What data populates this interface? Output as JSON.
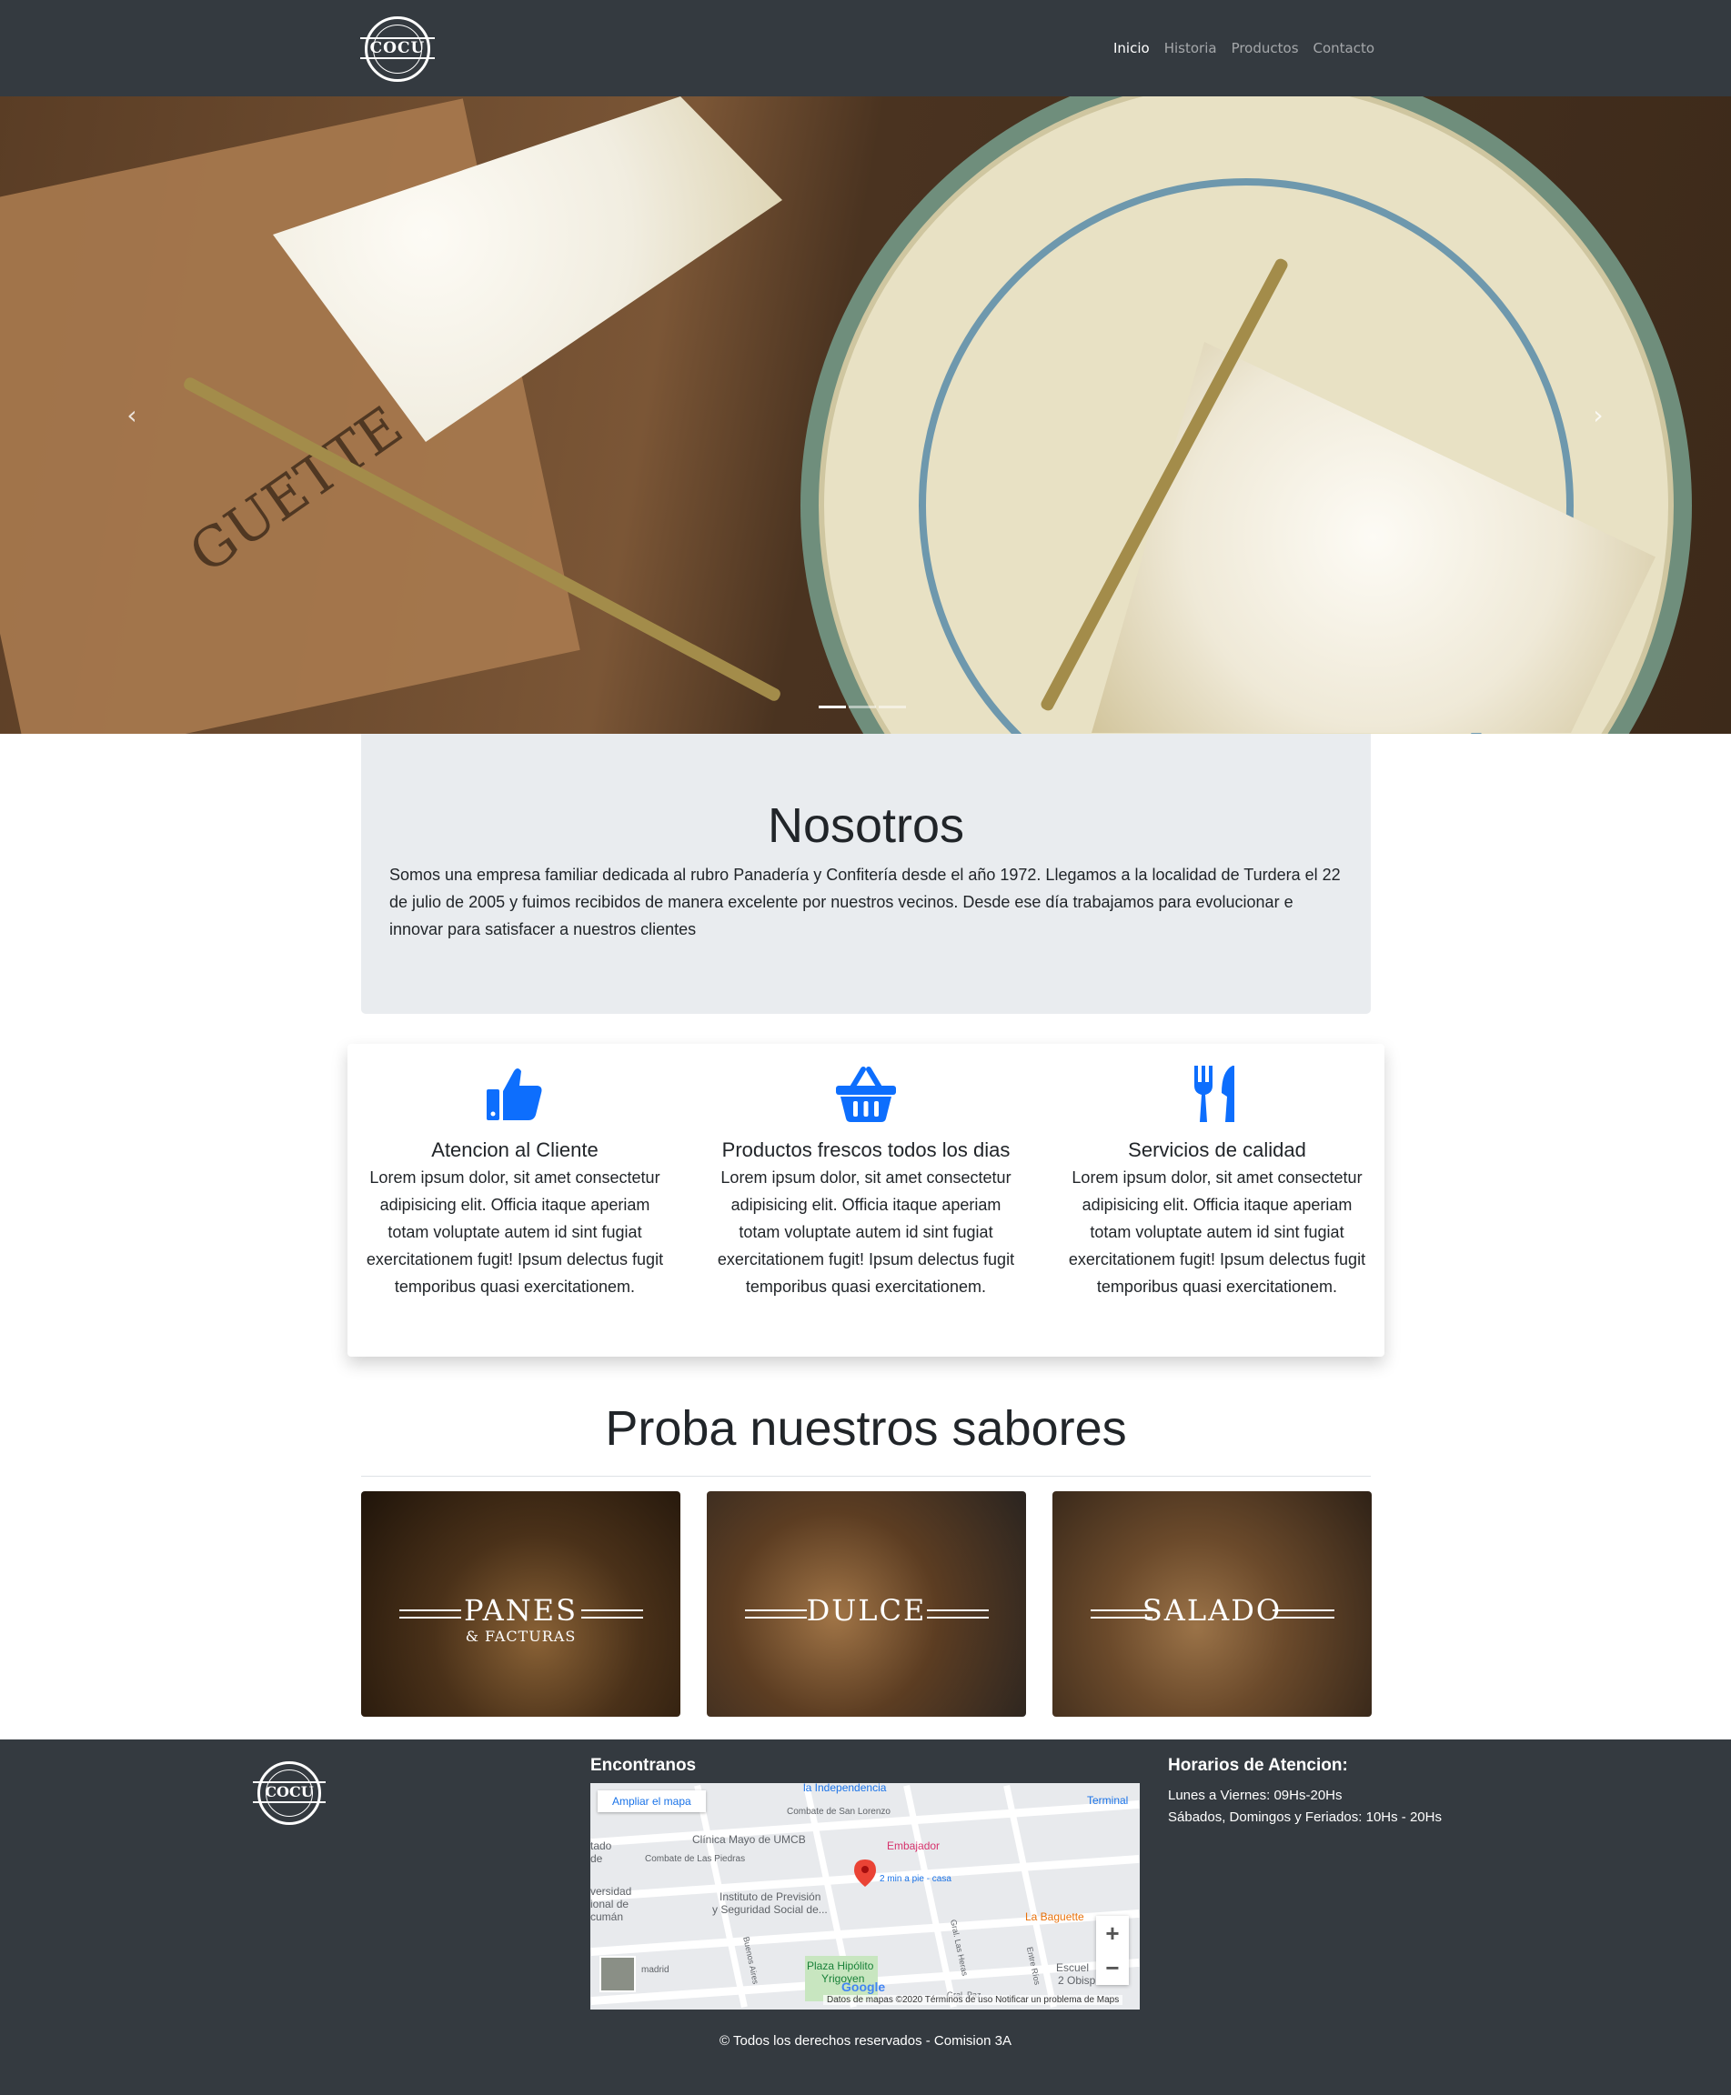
{
  "nav": {
    "logo_text": "COCU",
    "links": [
      {
        "label": "Inicio",
        "active": true
      },
      {
        "label": "Historia",
        "active": false
      },
      {
        "label": "Productos",
        "active": false
      },
      {
        "label": "Contacto",
        "active": false
      }
    ]
  },
  "hero": {
    "slide_count": 3,
    "active_slide": 1,
    "paper_text": "GUETTE"
  },
  "nosotros": {
    "title": "Nosotros",
    "body": "Somos una empresa familiar dedicada al rubro Panadería y Confitería desde el año 1972. Llegamos a la localidad de Turdera el 22 de julio de 2005 y fuimos recibidos de manera excelente por nuestros vecinos. Desde ese día trabajamos para evolucionar e innovar para satisfacer a nuestros clientes"
  },
  "features": [
    {
      "icon": "thumbs-up-icon",
      "title": "Atencion al Cliente",
      "text": "Lorem ipsum dolor, sit amet consectetur adipisicing elit. Officia itaque aperiam totam voluptate autem id sint fugiat exercitationem fugit! Ipsum delectus fugit temporibus quasi exercitationem."
    },
    {
      "icon": "basket-icon",
      "title": "Productos frescos todos los dias",
      "text": "Lorem ipsum dolor, sit amet consectetur adipisicing elit. Officia itaque aperiam totam voluptate autem id sint fugiat exercitationem fugit! Ipsum delectus fugit temporibus quasi exercitationem."
    },
    {
      "icon": "utensils-icon",
      "title": "Servicios de calidad",
      "text": "Lorem ipsum dolor, sit amet consectetur adipisicing elit. Officia itaque aperiam totam voluptate autem id sint fugiat exercitationem fugit! Ipsum delectus fugit temporibus quasi exercitationem."
    }
  ],
  "icon_color": "#0d6efd",
  "sabores": {
    "title": "Proba nuestros sabores",
    "cards": [
      {
        "title": "PANES",
        "subtitle": "& FACTURAS"
      },
      {
        "title": "DULCE",
        "subtitle": ""
      },
      {
        "title": "SALADO",
        "subtitle": ""
      }
    ]
  },
  "footer": {
    "logo_text": "COCU",
    "map_heading": "Encontranos",
    "hours_heading": "Horarios de Atencion:",
    "hours": [
      "Lunes a Viernes: 09Hs-20Hs",
      "Sábados, Domingos y Feriados: 10Hs - 20Hs"
    ],
    "copyright": "© Todos los derechos reservados - Comision 3A",
    "map": {
      "ampliar": "Ampliar el mapa",
      "labels": {
        "independencia": "la Independencia",
        "terminal": "Terminal",
        "san_lorenzo_a": "Combate de San Lorenzo",
        "san_lorenzo_b": "Combate de San Lorenzo",
        "piedras": "Combate de Las Piedras",
        "clinica": "Clínica Mayo de UMCB",
        "embajador": "Embajador",
        "instituto_1": "Instituto de Previsión",
        "instituto_2": "y Seguridad Social de...",
        "caminando": "2 min a pie - casa",
        "baguette": "La Baguette",
        "plaza_1": "Plaza Hipólito",
        "plaza_2": "Yrigoyen",
        "tado": "tado",
        "de": "de",
        "versidad": "versidad",
        "ional_de": "ional de",
        "cuman": "cumán",
        "madrid": "madrid",
        "escuela": "Escuel",
        "obispo": "2 Obisp",
        "buenos_aires": "Buenos Aires",
        "las_heras": "Gral. Las Heras",
        "entre_rios": "Entre Ríos",
        "gral_paz": "Gral. Paz"
      },
      "zoom_in": "+",
      "zoom_out": "−",
      "google": "Google",
      "attribution": "Datos de mapas ©2020   Términos de uso   Notificar un problema de Maps"
    }
  }
}
